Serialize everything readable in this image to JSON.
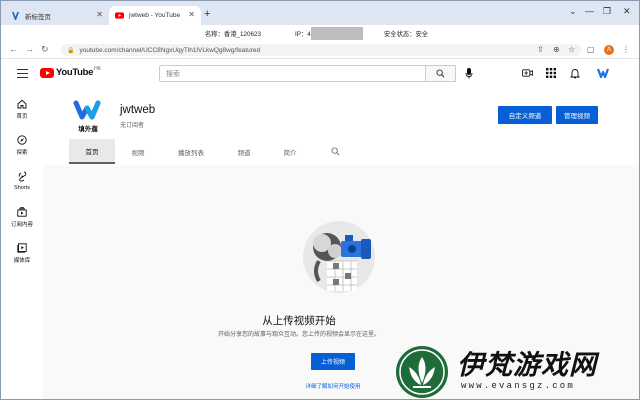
{
  "browser": {
    "tabs": [
      {
        "label": "新标签页",
        "active": false
      },
      {
        "label": "jwtweb - YouTube",
        "active": true
      }
    ],
    "new_tab": "+",
    "window_controls": [
      "⌄",
      "—",
      "❐",
      "✕"
    ],
    "info": {
      "name": "名称：香港_120623",
      "ip": "IP：43.",
      "security": "安全状态：安全"
    },
    "url": "youtube.com/channel/UCC8NgxUqyTlh1lVLkwQg8wg/featured",
    "avatar_letter": "A"
  },
  "youtube": {
    "logo_text": "YouTube",
    "region": "HK",
    "search_placeholder": "搜索",
    "sidebar": [
      {
        "label": "首页",
        "icon": "home-icon"
      },
      {
        "label": "探索",
        "icon": "explore-icon"
      },
      {
        "label": "Shorts",
        "icon": "shorts-icon"
      },
      {
        "label": "订阅内容",
        "icon": "subscriptions-icon"
      },
      {
        "label": "媒体库",
        "icon": "library-icon"
      }
    ],
    "channel": {
      "name": "jwtweb",
      "subscribers": "无订阅者",
      "logo_caption": "填外遛",
      "customize_label": "自定义频道",
      "manage_label": "管理视频"
    },
    "tabs": [
      "首页",
      "视频",
      "播放列表",
      "频道",
      "简介"
    ],
    "empty": {
      "title": "从上传视频开始",
      "desc": "开始分享您的故事与观众互动。您上传的视频会显示在这里。",
      "upload_label": "上传视频",
      "help_link": "详细了解如何开始使用"
    }
  },
  "watermark": {
    "title": "伊梵游戏网",
    "url": "www.evansgz.com"
  },
  "colors": {
    "brand_red": "#ff0000",
    "accent_blue": "#065fd4",
    "watermark_green": "#1f6b3a"
  }
}
